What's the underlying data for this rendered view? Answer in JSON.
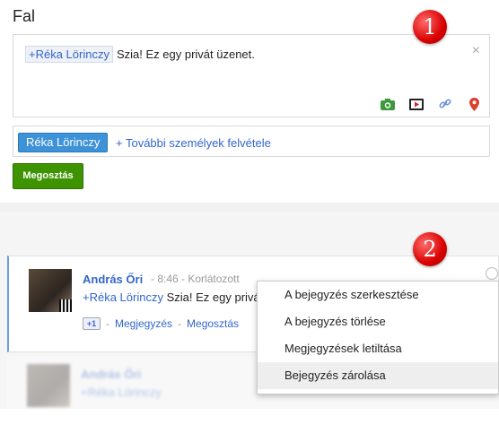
{
  "page": {
    "title": "Fal"
  },
  "compose": {
    "mention": "+Réka Lörinczy",
    "message": "Szia! Ez egy privát üzenet.",
    "close": "×",
    "tools": [
      "camera-icon",
      "video-icon",
      "link-icon",
      "location-pin-icon"
    ]
  },
  "share": {
    "recipient_chip": "Réka Lörinczy",
    "add_more": "+ További személyek felvétele",
    "button": "Megosztás"
  },
  "post": {
    "author": "András Őri",
    "time": "- 8:46 - Korlátozott",
    "mention": "+Réka Lörinczy",
    "text": "Szia! Ez egy privát",
    "plusone": "+1",
    "comment": "Megjegyzés",
    "share": "Megosztás",
    "sep": "-"
  },
  "menu": {
    "items": [
      "A bejegyzés szerkesztése",
      "A bejegyzés törlése",
      "Megjegyzések letiltása",
      "Bejegyzés zárolása"
    ]
  },
  "badges": [
    "1",
    "2"
  ],
  "colors": {
    "accent": "#3366cc",
    "share_button": "#3d9400",
    "chip": "#3d92d8",
    "badge": "#d90000"
  }
}
